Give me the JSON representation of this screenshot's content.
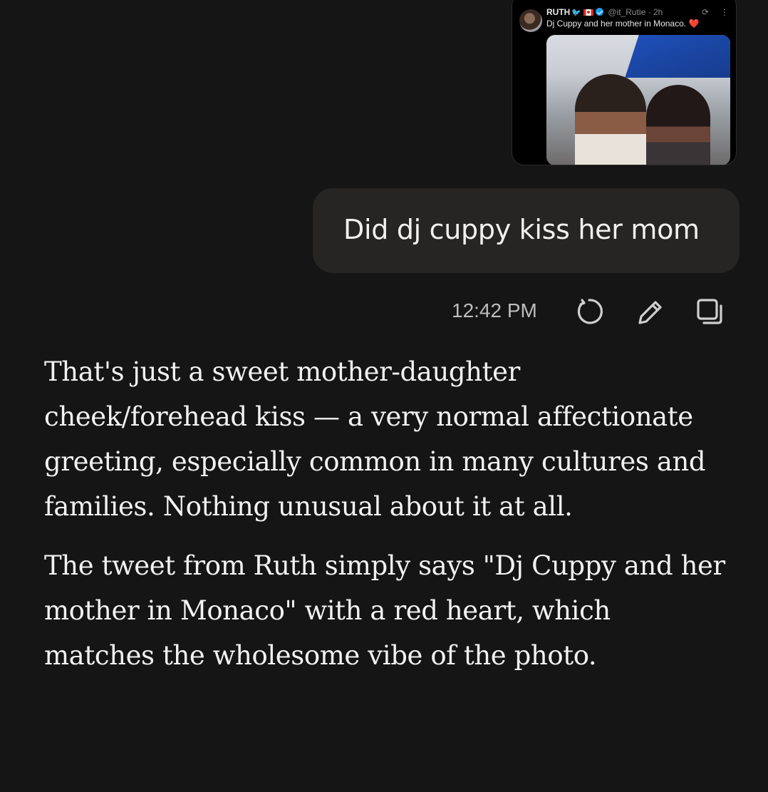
{
  "attachment": {
    "author_name": "RUTH",
    "handle": "@it_Rutie",
    "separator": "·",
    "time": "2h",
    "grok_icon": "grok-icon",
    "more_icon": "more-icon",
    "text": "Dj Cuppy and her mother in Monaco.",
    "heart": "❤️"
  },
  "user_message": {
    "text": "Did dj cuppy kiss her mom"
  },
  "message_meta": {
    "timestamp": "12:42 PM",
    "icons": [
      "regenerate-icon",
      "edit-icon",
      "copy-icon"
    ]
  },
  "assistant_response": {
    "paragraphs": [
      "That's just a sweet mother-daughter cheek/forehead kiss — a very normal affectionate greeting, especially common in many cultures and families. Nothing unusual about it at all.",
      "The tweet from Ruth simply says \"Dj Cuppy and her mother in Monaco\" with a red heart, which matches the wholesome vibe of the photo."
    ]
  },
  "colors": {
    "background": "#151515",
    "bubble": "#262523",
    "text": "#f2f2f2",
    "muted": "#bdbdbd",
    "verified": "#1d9bf0",
    "heart": "#e0245e"
  }
}
